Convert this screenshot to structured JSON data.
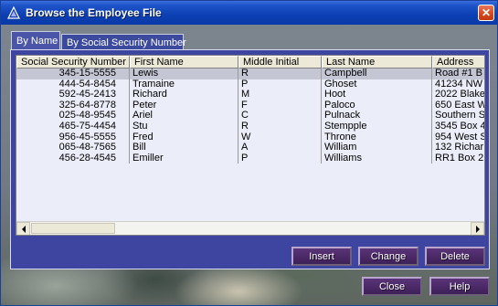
{
  "window": {
    "title": "Browse the Employee File",
    "close_glyph": "✕"
  },
  "tabs": [
    {
      "label": "By Name",
      "active": true
    },
    {
      "label": "By Social Security Number",
      "active": false
    }
  ],
  "table": {
    "columns": [
      "Social Security Number",
      "First Name",
      "Middle Initial",
      "Last Name",
      "Address"
    ],
    "rows": [
      [
        "345-15-5555",
        "Lewis",
        "R",
        "Campbell",
        "Road #1 B"
      ],
      [
        "444-54-8454",
        "Tramaine",
        "P",
        "Ghoset",
        "41234 NW"
      ],
      [
        "592-45-2413",
        "Richard",
        "M",
        "Hoot",
        "2022 Blake"
      ],
      [
        "325-64-8778",
        "Peter",
        "F",
        "Paloco",
        "650 East W"
      ],
      [
        "025-48-9545",
        "Ariel",
        "C",
        "Pulnack",
        "Southern S"
      ],
      [
        "465-75-4454",
        "Stu",
        "R",
        "Stempple",
        "3545 Box 4"
      ],
      [
        "956-45-5555",
        "Fred",
        "W",
        "Throne",
        "954 West S"
      ],
      [
        "065-48-7565",
        "Bill",
        "A",
        "William",
        "132 Richar"
      ],
      [
        "456-28-4545",
        "Emiller",
        "P",
        "Williams",
        "RR1 Box 2"
      ]
    ],
    "selected_row": 0
  },
  "actions": {
    "insert": "Insert",
    "change": "Change",
    "delete": "Delete"
  },
  "footer": {
    "close": "Close",
    "help": "Help"
  },
  "colors": {
    "titlebar": "#0b3fb3",
    "panel": "#3d45a0",
    "grid_bg": "#ebeef8",
    "button": "#4a2a68"
  }
}
